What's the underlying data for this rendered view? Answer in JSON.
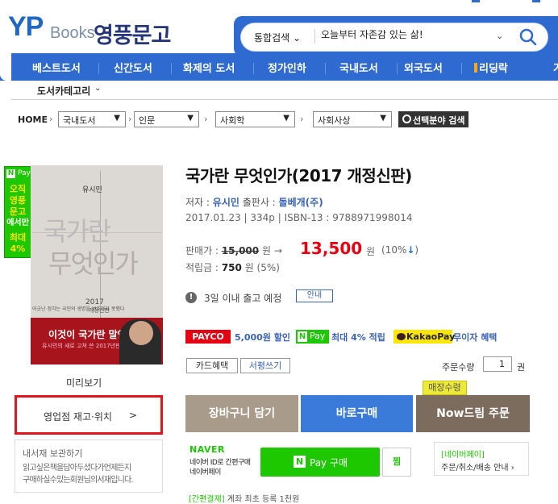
{
  "header": {
    "logo_yp": "YP",
    "logo_books": "Books",
    "logo_kr": "영풍문고",
    "search_category": "통합검색",
    "search_value": "오늘부터 자존감 있는 삶!"
  },
  "nav": {
    "items": [
      "베스트도서",
      "신간도서",
      "화제의 도서",
      "정가인하",
      "국내도서",
      "외국도서",
      "리딩락"
    ],
    "category_label": "도서카테고리"
  },
  "breadcrumb": {
    "home": "HOME",
    "levels": [
      "국내도서",
      "인문",
      "사회학",
      "사회사상"
    ],
    "search_button": "선택분야 검색"
  },
  "side_badge": {
    "top": "Pay",
    "lines": [
      "오직",
      "영풍",
      "문고",
      "에서만",
      "최대",
      "4%"
    ]
  },
  "cover": {
    "author": "유시민",
    "title_line1": "국가란",
    "title_line2": "무엇인가",
    "year": "2017",
    "edition": "개정신판",
    "red_title": "이것이 국가란 말인가?",
    "red_sub": "유시민의 새로 고쳐 쓴 2017년판 국가론",
    "small": "어긋난 정치는 국민의 생명을 보호하지 못했다"
  },
  "preview_label": "미리보기",
  "stock_box": {
    "label": "영업점 재고·위치",
    "arrow": ">"
  },
  "save_box": {
    "title": "내서재 보관하기",
    "desc1": "읽고싶은책을담아두셨다가언제든지",
    "desc2": "구매하실수있는회원님의서재입니다."
  },
  "product": {
    "title": "국가란 무엇인가(2017 개정신판)",
    "author_label": "저자 :",
    "author": "유시민",
    "publisher_label": "출판사 :",
    "publisher": "돌베개(주)",
    "date": "2017.01.23",
    "pages": "334p",
    "isbn": "ISBN-13 : 9788971998014",
    "price_label": "판매가 :",
    "original_price": "15,000",
    "won": "원",
    "arrow": "→",
    "sale_price": "13,500",
    "discount": "(10%",
    "discount_close": ")",
    "points_label": "적립금 :",
    "points": "750",
    "points_rate": "원 (5%)",
    "shipping": "3일 이내 출고 예정",
    "shipping_btn": "안내"
  },
  "promos": {
    "payco": "PAYCO",
    "payco_text": "5,000원 할인",
    "npay_pay": "Pay",
    "npay_text": "최대 4% 적립",
    "kakao": "KakaoPay",
    "kakao_text": "무이자 혜택"
  },
  "buttons": {
    "card": "카드혜택",
    "review": "서평쓰기",
    "qty_label": "주문수량",
    "qty_value": "1",
    "qty_unit": "권",
    "cart": "장바구니 담기",
    "buy": "바로구매",
    "now": "Now드림 주문",
    "store_tag": "매장수령"
  },
  "naver": {
    "logo": "NAVER",
    "desc1": "네이버 ID로 간편구매",
    "desc2": "네이버페이",
    "buy_text": "Pay 구매",
    "zzim": "찜",
    "info_title": "[네이버페이]",
    "info_sub": "주문/취소/배송 안내",
    "info_arrow": "›"
  },
  "easy_pay": {
    "label": "[간편결제]",
    "text": "계좌 최초 등록 1천원"
  }
}
